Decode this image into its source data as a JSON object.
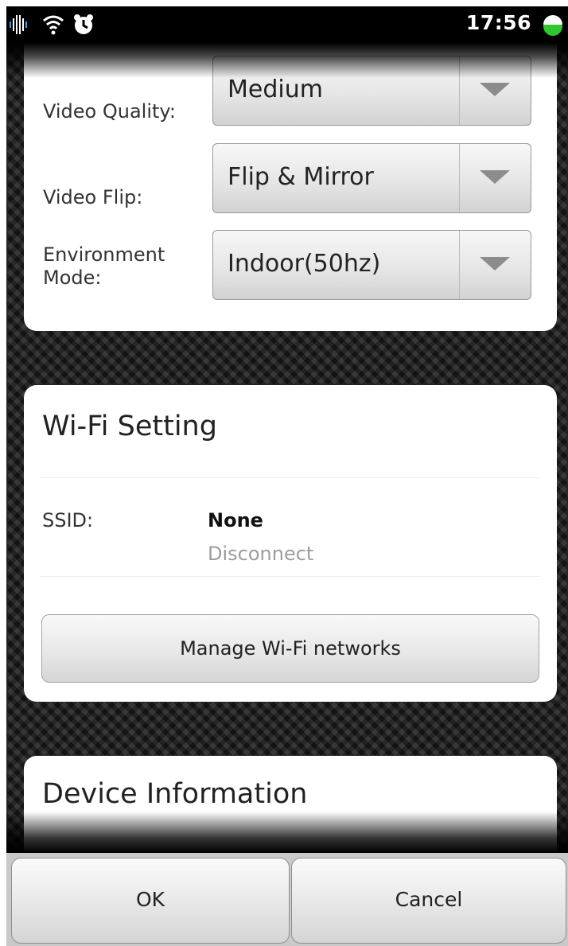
{
  "status_bar": {
    "time": "17:56",
    "icons": [
      "signal-bars-icon",
      "wifi-icon",
      "alarm-clock-icon",
      "battery-icon"
    ]
  },
  "video_settings": {
    "rows": [
      {
        "label": "Video Quality:",
        "value": "Medium"
      },
      {
        "label": "Video Flip:",
        "value": "Flip & Mirror"
      },
      {
        "label": "Environment\nMode:",
        "value": "Indoor(50hz)"
      }
    ]
  },
  "wifi_setting": {
    "title": "Wi-Fi Setting",
    "ssid_label": "SSID:",
    "ssid_value": "None",
    "ssid_status": "Disconnect",
    "manage_button": "Manage Wi-Fi networks"
  },
  "device_information": {
    "title": "Device Information"
  },
  "bottom_bar": {
    "ok_label": "OK",
    "cancel_label": "Cancel"
  },
  "colors": {
    "battery": "#2ec82e",
    "card_background": "#ffffff",
    "hint_text": "#9c9c9c"
  }
}
